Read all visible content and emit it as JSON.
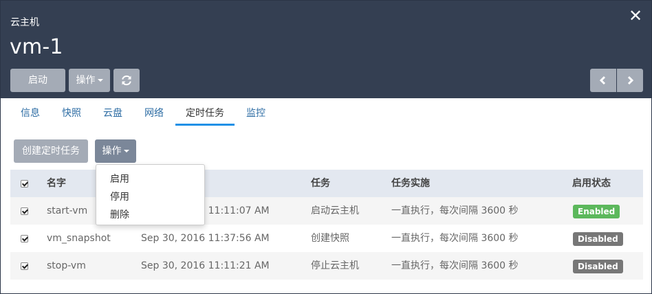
{
  "header": {
    "subtitle": "云主机",
    "title": "vm-1",
    "close_icon": "close-icon",
    "buttons": {
      "start": "启动",
      "actions": "操作"
    }
  },
  "tabs": [
    {
      "label": "信息"
    },
    {
      "label": "快照"
    },
    {
      "label": "云盘"
    },
    {
      "label": "网络"
    },
    {
      "label": "定时任务",
      "active": true
    },
    {
      "label": "监控"
    }
  ],
  "toolbar": {
    "create_label": "创建定时任务",
    "actions_label": "操作"
  },
  "dropdown": {
    "items": [
      "启用",
      "停用",
      "删除"
    ]
  },
  "table": {
    "columns": [
      "名字",
      "",
      "任务",
      "任务实施",
      "启用状态"
    ],
    "rows": [
      {
        "checked": true,
        "name": "start-vm",
        "time": "Sep 30, 2016 11:11:07 AM",
        "task": "启动云主机",
        "schedule": "一直执行，每次间隔 3600 秒",
        "status": "Enabled"
      },
      {
        "checked": true,
        "name": "vm_snapshot",
        "time": "Sep 30, 2016 11:37:56 AM",
        "task": "创建快照",
        "schedule": "一直执行，每次间隔 3600 秒",
        "status": "Disabled"
      },
      {
        "checked": true,
        "name": "stop-vm",
        "time": "Sep 30, 2016 11:11:21 AM",
        "task": "停止云主机",
        "schedule": "一直执行，每次间隔 3600 秒",
        "status": "Disabled"
      }
    ]
  },
  "colors": {
    "header_bg": "#343f52",
    "button_gray": "#a4abb6",
    "tab_link": "#2e6da4",
    "tab_active_underline": "#1e90e6",
    "enabled": "#5cb85c",
    "disabled": "#777777"
  }
}
